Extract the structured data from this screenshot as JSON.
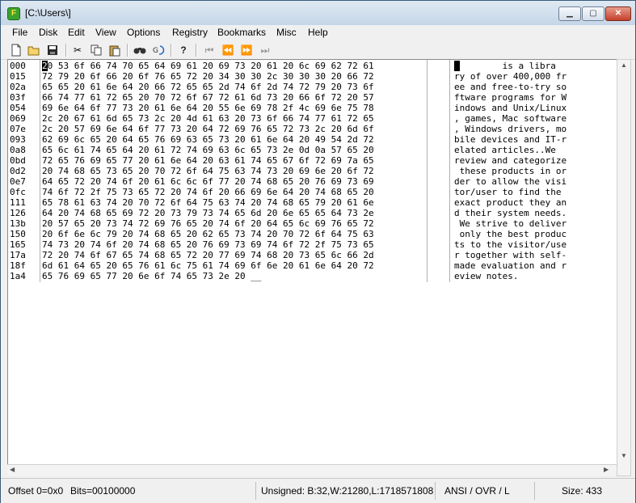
{
  "window": {
    "title": "[C:\\Users\\]",
    "icon_letter": "F"
  },
  "menu": [
    "File",
    "Disk",
    "Edit",
    "View",
    "Options",
    "Registry",
    "Bookmarks",
    "Misc",
    "Help"
  ],
  "toolbar": {
    "icons": [
      "new-file-icon",
      "open-folder-icon",
      "save-icon",
      "cut-icon",
      "copy-icon",
      "paste-icon",
      "find-icon",
      "goto-icon",
      "help-icon",
      "first-record-icon",
      "prev-record-icon",
      "next-record-icon",
      "last-record-icon"
    ]
  },
  "editor": {
    "offsets": [
      "000",
      "015",
      "02a",
      "03f",
      "054",
      "069",
      "07e",
      "093",
      "0a8",
      "0bd",
      "0d2",
      "0e7",
      "0fc",
      "111",
      "126",
      "13b",
      "150",
      "165",
      "17a",
      "18f",
      "1a4"
    ],
    "hex_rows": [
      "20 53 6f 66 74 70 65 64 69 61 20 69 73 20 61 20 6c 69 62 72 61",
      "72 79 20 6f 66 20 6f 76 65 72 20 34 30 30 2c 30 30 30 20 66 72",
      "65 65 20 61 6e 64 20 66 72 65 65 2d 74 6f 2d 74 72 79 20 73 6f",
      "66 74 77 61 72 65 20 70 72 6f 67 72 61 6d 73 20 66 6f 72 20 57",
      "69 6e 64 6f 77 73 20 61 6e 64 20 55 6e 69 78 2f 4c 69 6e 75 78",
      "2c 20 67 61 6d 65 73 2c 20 4d 61 63 20 73 6f 66 74 77 61 72 65",
      "2c 20 57 69 6e 64 6f 77 73 20 64 72 69 76 65 72 73 2c 20 6d 6f",
      "62 69 6c 65 20 64 65 76 69 63 65 73 20 61 6e 64 20 49 54 2d 72",
      "65 6c 61 74 65 64 20 61 72 74 69 63 6c 65 73 2e 0d 0a 57 65 20",
      "72 65 76 69 65 77 20 61 6e 64 20 63 61 74 65 67 6f 72 69 7a 65",
      "20 74 68 65 73 65 20 70 72 6f 64 75 63 74 73 20 69 6e 20 6f 72",
      "64 65 72 20 74 6f 20 61 6c 6c 6f 77 20 74 68 65 20 76 69 73 69",
      "74 6f 72 2f 75 73 65 72 20 74 6f 20 66 69 6e 64 20 74 68 65 20",
      "65 78 61 63 74 20 70 72 6f 64 75 63 74 20 74 68 65 79 20 61 6e",
      "64 20 74 68 65 69 72 20 73 79 73 74 65 6d 20 6e 65 65 64 73 2e",
      "20 57 65 20 73 74 72 69 76 65 20 74 6f 20 64 65 6c 69 76 65 72",
      "20 6f 6e 6c 79 20 74 68 65 20 62 65 73 74 20 70 72 6f 64 75 63",
      "74 73 20 74 6f 20 74 68 65 20 76 69 73 69 74 6f 72 2f 75 73 65",
      "72 20 74 6f 67 65 74 68 65 72 20 77 69 74 68 20 73 65 6c 66 2d",
      "6d 61 64 65 20 65 76 61 6c 75 61 74 69 6f 6e 20 61 6e 64 20 72",
      "65 76 69 65 77 20 6e 6f 74 65 73 2e 20 __"
    ],
    "ascii_rows": [
      "  is a libra",
      "ry of over 400,000 fr",
      "ee and free-to-try so",
      "ftware programs for W",
      "indows and Unix/Linux",
      ", games, Mac software",
      ", Windows drivers, mo",
      "bile devices and IT-r",
      "elated articles..We",
      "review and categorize",
      " these products in or",
      "der to allow the visi",
      "tor/user to find the",
      "exact product they an",
      "d their system needs.",
      " We strive to deliver",
      " only the best produc",
      "ts to the visitor/use",
      "r together with self-",
      "made evaluation and r",
      "eview notes."
    ],
    "cursor_hex": "2",
    "cursor_ascii": " "
  },
  "status": {
    "offset": "Offset 0=0x0",
    "bits": "Bits=00100000",
    "unsigned": "Unsigned: B:32,W:21280,L:1718571808",
    "mode": "ANSI / OVR / L",
    "size": "Size: 433"
  }
}
